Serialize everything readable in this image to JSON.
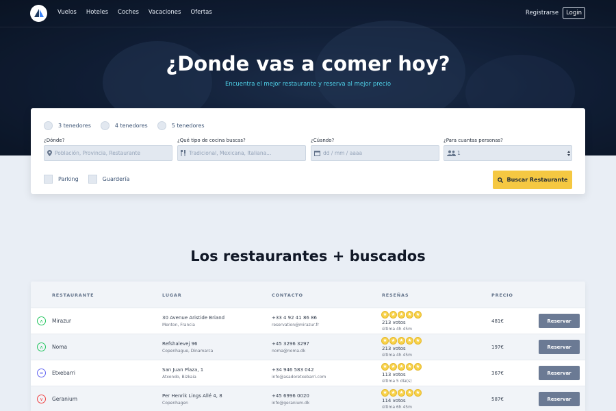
{
  "nav": {
    "links": [
      "Vuelos",
      "Hoteles",
      "Coches",
      "Vacaciones",
      "Ofertas"
    ],
    "register_label": "Registrarse",
    "login_label": "Login"
  },
  "hero": {
    "title": "¿Donde vas a comer hoy?",
    "subtitle": "Encuentra el mejor restaurante y reserva al mejor precio"
  },
  "search": {
    "ratings": [
      "3 tenedores",
      "4 tenedores",
      "5 tenedores"
    ],
    "where_label": "¿Dónde?",
    "where_placeholder": "Población, Provincia, Restaurante",
    "cuisine_label": "¿Qué tipo de cocina buscas?",
    "cuisine_placeholder": "Tradicional, Mexicana, Italiana...",
    "when_label": "¿Cúando?",
    "when_placeholder": "dd / mm / aaaa",
    "people_label": "¿Para cuantas personas?",
    "people_value": "1",
    "amenities": [
      "Parking",
      "Guardería"
    ],
    "button_label": "Buscar Restaurante",
    "accent_color": "#f5c842"
  },
  "section": {
    "title": "Los restaurantes + buscados"
  },
  "table": {
    "headers": [
      "RESTAURANTE",
      "LUGAR",
      "CONTACTO",
      "RESEÑAS",
      "PRECIO"
    ],
    "reserve_label": "Reservar",
    "rows": [
      {
        "icon": "up-arrow-icon",
        "icon_color": "#22c55e",
        "icon_glyph": "∧",
        "name": "Mirazur",
        "address": "30 Avenue Aristide Briand",
        "city": "Menton, Francia",
        "phone": "+33 4 92 41 86 86",
        "email": "reservation@mirazur.fr",
        "stars": 5,
        "votes": "213 votos",
        "ago": "última 4h 45m",
        "price": "481€"
      },
      {
        "icon": "up-arrow-icon",
        "icon_color": "#22c55e",
        "icon_glyph": "∧",
        "name": "Noma",
        "address": "Refshalevej 96",
        "city": "Copenhague, Dinamarca",
        "phone": "+45 3296 3297",
        "email": "noma@noma.dk",
        "stars": 5,
        "votes": "213 votos",
        "ago": "última 4h 45m",
        "price": "197€"
      },
      {
        "icon": "equal-icon",
        "icon_color": "#6366f1",
        "icon_glyph": "=",
        "name": "Etxebarri",
        "address": "San Juan Plaza, 1",
        "city": "Atxondo, Bizkaia",
        "phone": "+34 946 583 042",
        "email": "info@asadoretxebarri.com",
        "stars": 5,
        "votes": "113 votos",
        "ago": "última 5 día(s)",
        "price": "367€"
      },
      {
        "icon": "down-arrow-icon",
        "icon_color": "#ef4444",
        "icon_glyph": "∨",
        "name": "Geranium",
        "address": "Per Henrik Lings Allé 4, 8",
        "city": "Copenhagen",
        "phone": "+45 6996 0020",
        "email": "info@geranium.dk",
        "stars": 5,
        "votes": "114 votos",
        "ago": "última 6h 45m",
        "price": "587€"
      }
    ]
  }
}
